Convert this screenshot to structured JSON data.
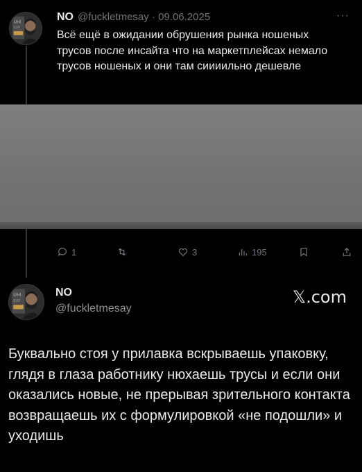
{
  "tweet1": {
    "author_name": "NO",
    "handle_date": "@fuckletmesay · 09.06.2025",
    "more_icon": "more-dots-icon",
    "text": "Всё ещё в ожидании обрушения рынка ношеных трусов после инсайта что на маркетплейсах немало трусов ношеных и они там сиииильно дешевле",
    "actions": {
      "reply_count": "1",
      "retweet_count": "",
      "like_count": "3",
      "views_count": "195"
    }
  },
  "tweet2": {
    "author_name": "NO",
    "handle": "@fuckletmesay",
    "brand": "𝕏.com",
    "text": "Буквально стоя у прилавка вскрываешь упаковку, глядя в глаза работнику нюхаешь трусы и если они оказались новые, не прерывая зрительного контакта возвращаешь их с формулировкой «не подошли» и уходишь"
  },
  "colors": {
    "background": "#000000",
    "text": "#e7e9ea",
    "muted": "#71767b",
    "media_gray": "#777779"
  }
}
